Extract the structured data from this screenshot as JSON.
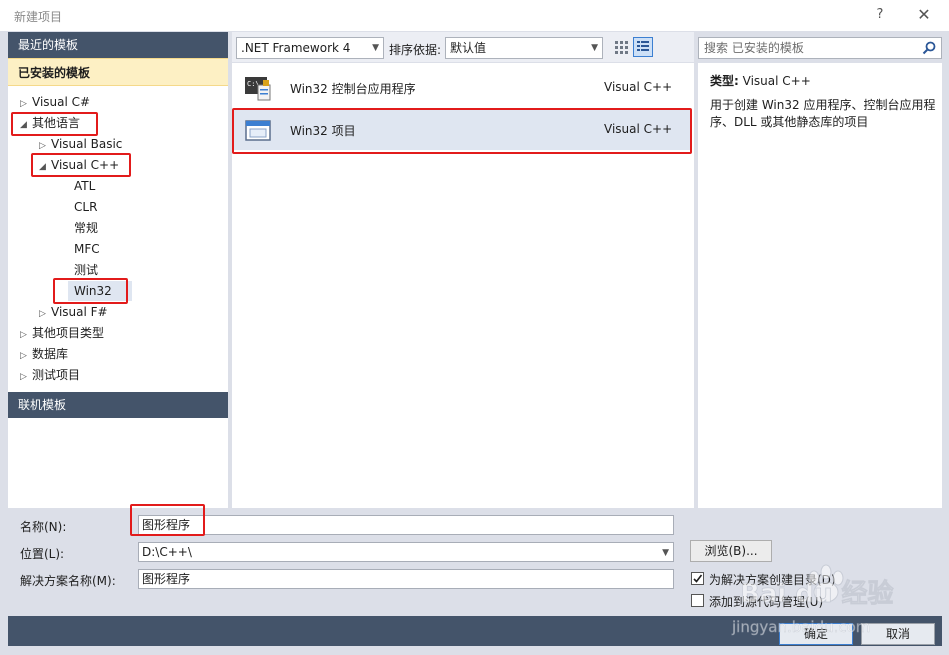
{
  "window": {
    "title": "新建项目",
    "help_label": "?",
    "close_label": "✕"
  },
  "left": {
    "recent_label": "最近的模板",
    "installed_label": "已安装的模板",
    "online_label": "联机模板",
    "tree": {
      "visual_csharp": "Visual C#",
      "other_languages": "其他语言",
      "visual_basic": "Visual Basic",
      "visual_cpp": "Visual C++",
      "atl": "ATL",
      "clr": "CLR",
      "general": "常规",
      "mfc": "MFC",
      "test": "测试",
      "win32": "Win32",
      "visual_fsharp": "Visual F#",
      "other_project_types": "其他项目类型",
      "database": "数据库",
      "test_projects": "测试项目"
    }
  },
  "toolbar": {
    "framework": ".NET Framework 4",
    "sort_label": "排序依据:",
    "sort_value": "默认值",
    "search_placeholder": "搜索 已安装的模板"
  },
  "templates": [
    {
      "name": "Win32 控制台应用程序",
      "language": "Visual C++"
    },
    {
      "name": "Win32 项目",
      "language": "Visual C++"
    }
  ],
  "details": {
    "type_label": "类型:",
    "type_value": "Visual C++",
    "description": "用于创建 Win32 应用程序、控制台应用程序、DLL 或其他静态库的项目"
  },
  "form": {
    "name_label": "名称(N):",
    "name_value": "图形程序",
    "location_label": "位置(L):",
    "location_value": "D:\\C++\\",
    "browse_label": "浏览(B)...",
    "solution_label": "解决方案名称(M):",
    "solution_value": "图形程序",
    "create_dir_label": "为解决方案创建目录(D)",
    "add_source_control_label": "添加到源代码管理(U)",
    "create_dir_checked": true,
    "add_source_control_checked": false
  },
  "buttons": {
    "ok_label": "确定",
    "cancel_label": "取消"
  },
  "watermark": {
    "brand": "Bai du 经验",
    "url": "jingyan.baidu.com"
  },
  "colors": {
    "highlight_red": "#e21b1b",
    "header_navy": "#44546a",
    "installed_bg": "#fdf0c4",
    "selected_row": "#dfe6f1"
  }
}
